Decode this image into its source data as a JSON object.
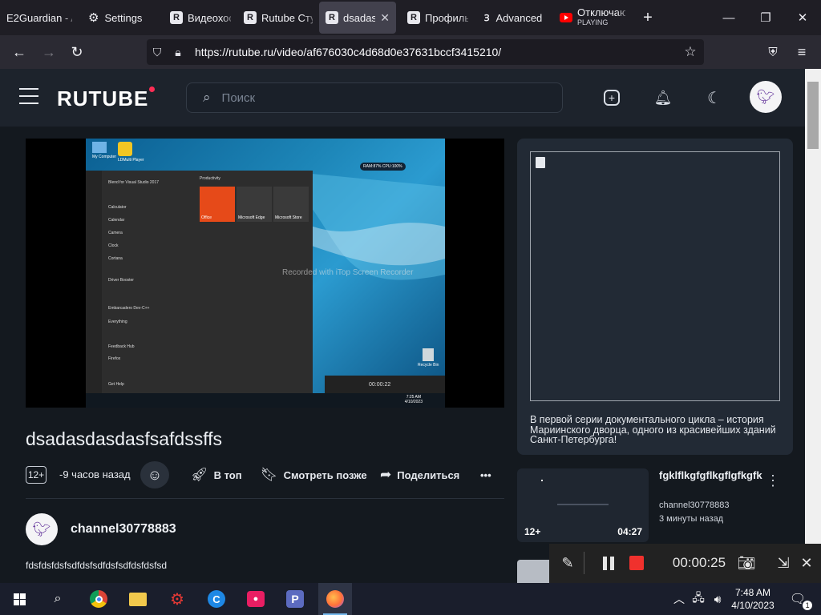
{
  "browser": {
    "tabs": [
      {
        "label": "E2Guardian - A",
        "icon": "e2guardian-icon",
        "active": false
      },
      {
        "label": "Settings",
        "icon": "gear-icon",
        "active": false
      },
      {
        "label": "Видеохост",
        "icon": "rutube-icon",
        "active": false
      },
      {
        "label": "Rutube Сту",
        "icon": "rutube-icon",
        "active": false
      },
      {
        "label": "dsadasd",
        "icon": "rutube-icon",
        "active": true
      },
      {
        "label": "Профиль",
        "icon": "rutube-icon",
        "active": false
      },
      {
        "label": "Advanced",
        "icon": "advanced-icon",
        "active": false
      },
      {
        "label": "Отключаю",
        "sublabel": "PLAYING",
        "icon": "youtube-icon",
        "active": false
      }
    ],
    "new_tab": "+",
    "url": "https://rutube.ru/video/af676030c4d68d0e37631bccf3415210/"
  },
  "site": {
    "logo": "RUTUBE",
    "search_placeholder": "Поиск"
  },
  "video": {
    "watermark": "Recorded with iTop Screen Recorder",
    "inner_timer": "00:00:22",
    "inner_desktop_icons": [
      "My Computer",
      "LDMulti Player"
    ],
    "inner_tiles_header": "Productivity",
    "inner_tiles": [
      "Office",
      "Microsoft Edge",
      "Microsoft Store"
    ],
    "inner_apps": [
      "Blend for Visual Studio 2017",
      "Calculator",
      "Calendar",
      "Camera",
      "Clock",
      "Cortana",
      "Driver Booster",
      "Embarcadero Dev-C++",
      "Everything",
      "Feedback Hub",
      "Firefox",
      "Get Help"
    ],
    "inner_clock": [
      "7:25 AM",
      "4/10/2023"
    ],
    "inner_stats": "RAM:87%  CPU:100%",
    "inner_recycle": "Recycle Bin",
    "title": "dsadasdasdasfsafdssffs",
    "age_rating": "12+",
    "published": "-9 часов назад",
    "actions": {
      "top": "В топ",
      "watch_later": "Смотреть позже",
      "share": "Поделиться",
      "more": "•••"
    },
    "channel": "channel30778883",
    "description": "fdsfdsfdsfsdfdsfsdfdsfsdfdsfdsfsd"
  },
  "ad": {
    "description": "В первой серии документального цикла – история Мариинского дворца, одного из красивейших зданий Санкт-Петербурга!"
  },
  "recommendation": {
    "title": "fgklflkgfgflkgflgfkgfk",
    "channel": "channel30778883",
    "time": "3 минуты назад",
    "age_rating": "12+",
    "duration": "04:27"
  },
  "recorder": {
    "timer": "00:00:25"
  },
  "taskbar": {
    "time": "7:48 AM",
    "date": "4/10/2023",
    "notification_count": "1"
  }
}
